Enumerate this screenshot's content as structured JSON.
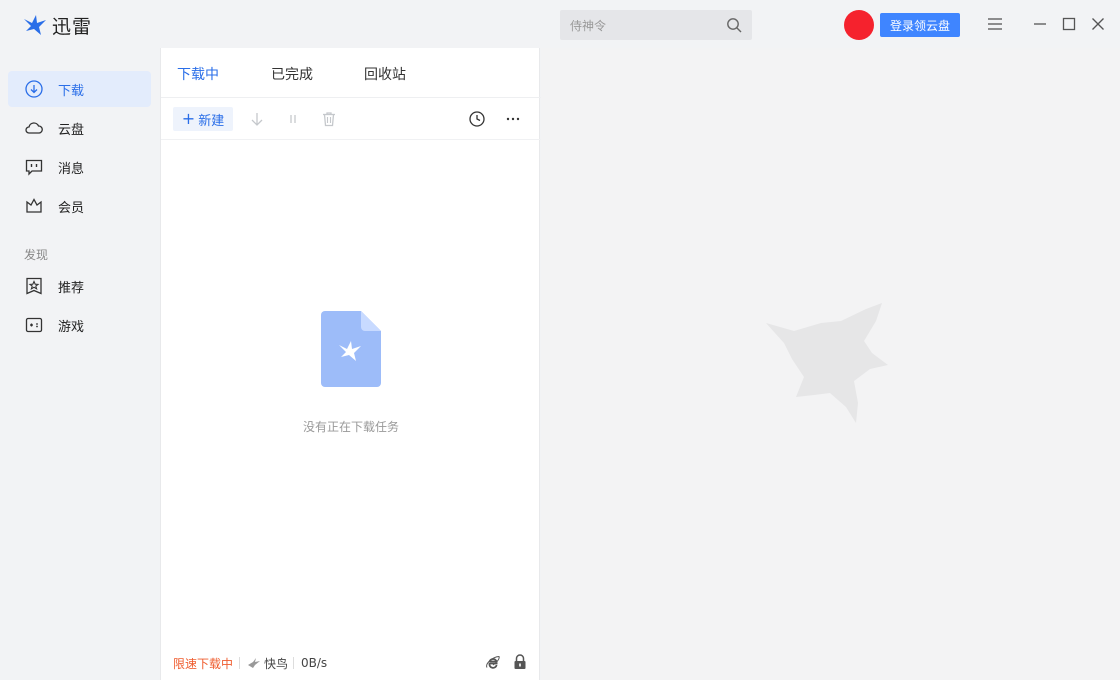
{
  "app": {
    "title": "迅雷"
  },
  "search": {
    "placeholder": "侍神令"
  },
  "header": {
    "login_label": "登录领云盘"
  },
  "sidebar": {
    "items": [
      {
        "label": "下载",
        "icon": "download-icon"
      },
      {
        "label": "云盘",
        "icon": "cloud-icon"
      },
      {
        "label": "消息",
        "icon": "message-icon"
      },
      {
        "label": "会员",
        "icon": "crown-icon"
      }
    ],
    "discover_label": "发现",
    "discover_items": [
      {
        "label": "推荐",
        "icon": "star-icon"
      },
      {
        "label": "游戏",
        "icon": "gamepad-icon"
      }
    ]
  },
  "tabs": [
    {
      "label": "下载中"
    },
    {
      "label": "已完成"
    },
    {
      "label": "回收站"
    }
  ],
  "toolbar": {
    "new_label": "新建"
  },
  "empty": {
    "text": "没有正在下载任务"
  },
  "status": {
    "limit": "限速下载中",
    "bird": "快鸟",
    "speed": "0B/s"
  },
  "colors": {
    "accent": "#2a6ee8",
    "login": "#3f85ff",
    "avatar": "#f5222d",
    "limit": "#ef5c2e"
  }
}
